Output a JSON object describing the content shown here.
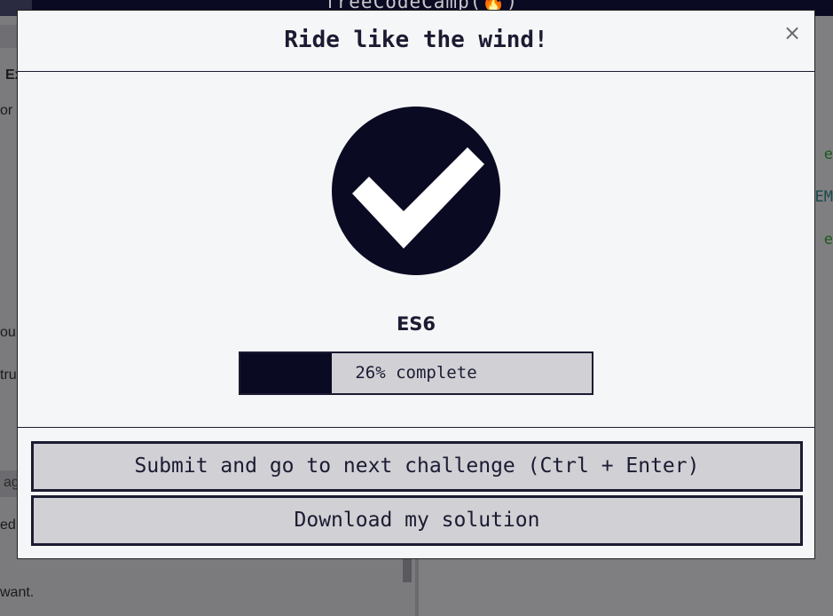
{
  "background": {
    "logo_text": "freeCodeCamp(🔥)",
    "left_fragments": [
      "Ex",
      "or r",
      "ou",
      "tru",
      "ag",
      "ed",
      "want."
    ],
    "right_fragments": [
      "e",
      "EM",
      "e"
    ]
  },
  "modal": {
    "title": "Ride like the wind!",
    "close_label": "×",
    "block_name": "ES6",
    "progress": {
      "percent": 26,
      "label": "26% complete"
    },
    "submit_label": "Submit and go to next challenge (Ctrl + Enter)",
    "download_label": "Download my solution"
  },
  "colors": {
    "modal_bg": "#f5f6f7",
    "dark": "#0a0a23",
    "text": "#1b1b32",
    "button_bg": "#d0d0d5"
  },
  "icons": {
    "success": "check-circle-icon",
    "close": "close-icon"
  }
}
